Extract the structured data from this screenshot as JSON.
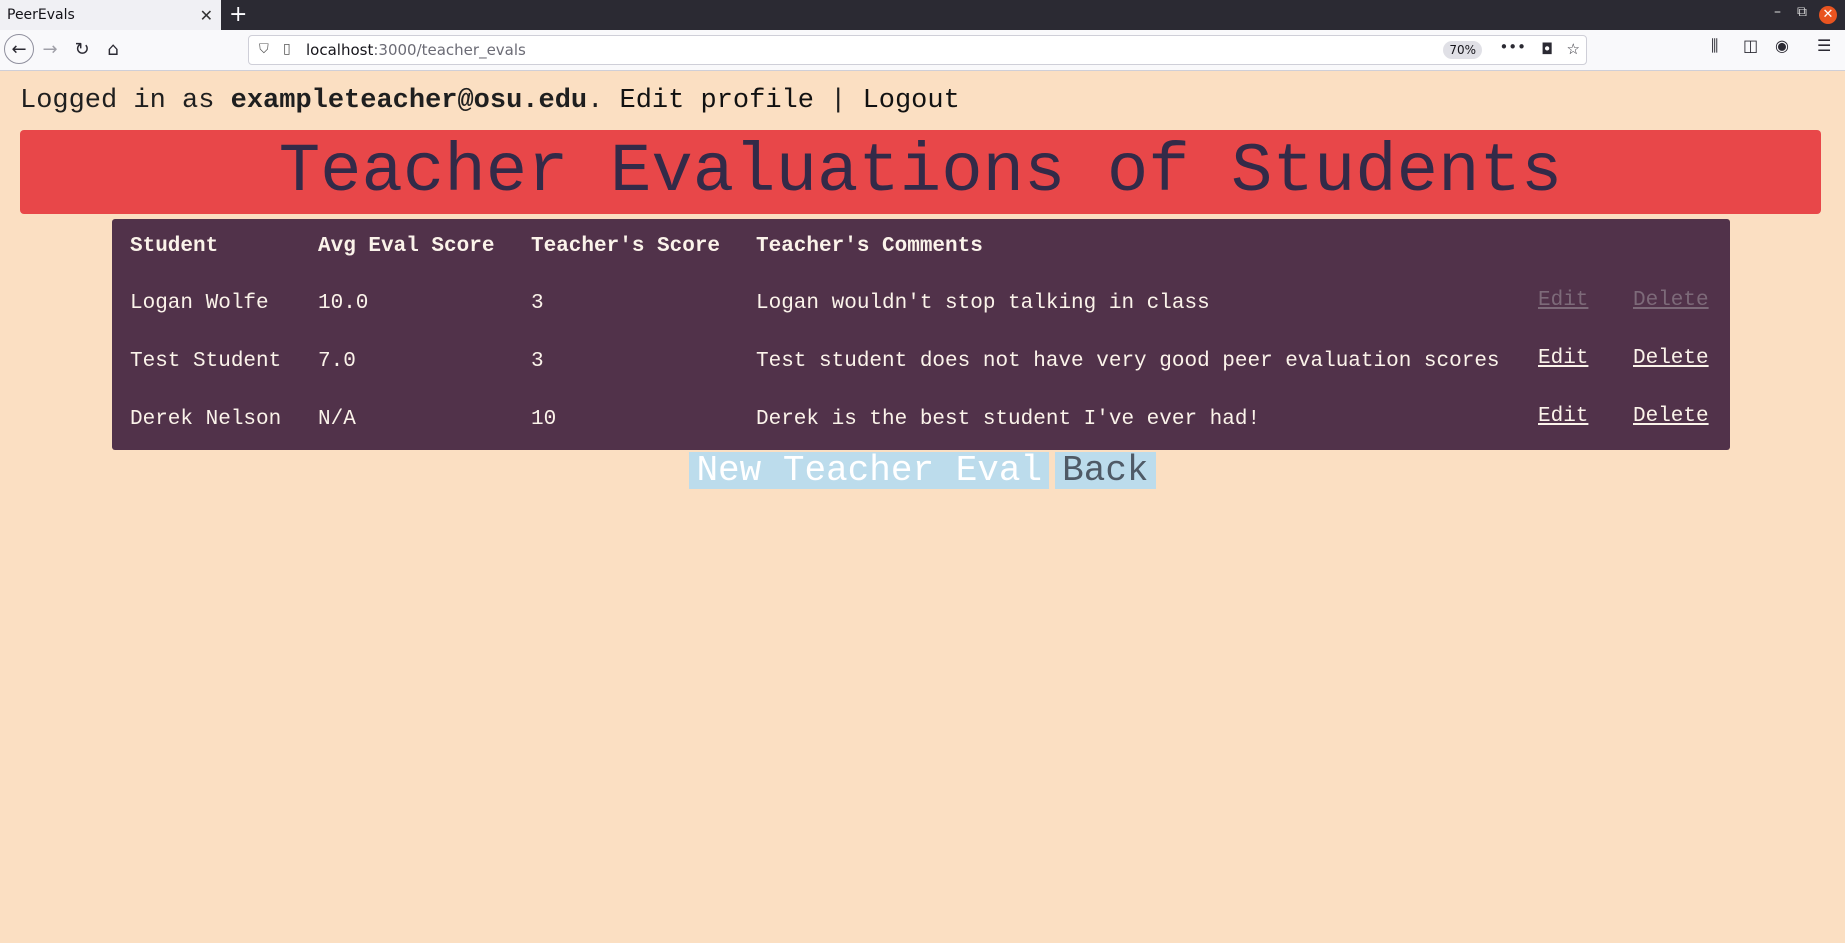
{
  "browser": {
    "tab_title": "PeerEvals",
    "url_host": "localhost",
    "url_path": ":3000/teacher_evals",
    "zoom": "70%"
  },
  "header": {
    "logged_in_prefix": "Logged in as ",
    "email": "exampleteacher@osu.edu",
    "separator_dot": ". ",
    "edit_profile": "Edit profile",
    "pipe": " | ",
    "logout": "Logout"
  },
  "page_title": "Teacher Evaluations of Students",
  "table": {
    "headers": [
      "Student",
      "Avg Eval Score",
      "Teacher's Score",
      "Teacher's Comments"
    ],
    "rows": [
      {
        "student": "Logan Wolfe",
        "avg": "10.0",
        "score": "3",
        "comment": "Logan wouldn't stop talking in class",
        "edit": "Edit",
        "delete": "Delete"
      },
      {
        "student": "Test Student",
        "avg": "7.0",
        "score": "3",
        "comment": "Test student does not have very good peer evaluation scores",
        "edit": "Edit",
        "delete": "Delete"
      },
      {
        "student": "Derek Nelson",
        "avg": "N/A",
        "score": "10",
        "comment": "Derek is the best student I've ever had!",
        "edit": "Edit",
        "delete": "Delete"
      }
    ]
  },
  "actions": {
    "new_eval": "New Teacher Eval",
    "back": "Back"
  },
  "colors": {
    "page_bg": "#fbdfc2",
    "banner_bg": "#e84749",
    "banner_text": "#332a48",
    "table_bg": "#51324a",
    "button_bg": "#bcdcec"
  }
}
